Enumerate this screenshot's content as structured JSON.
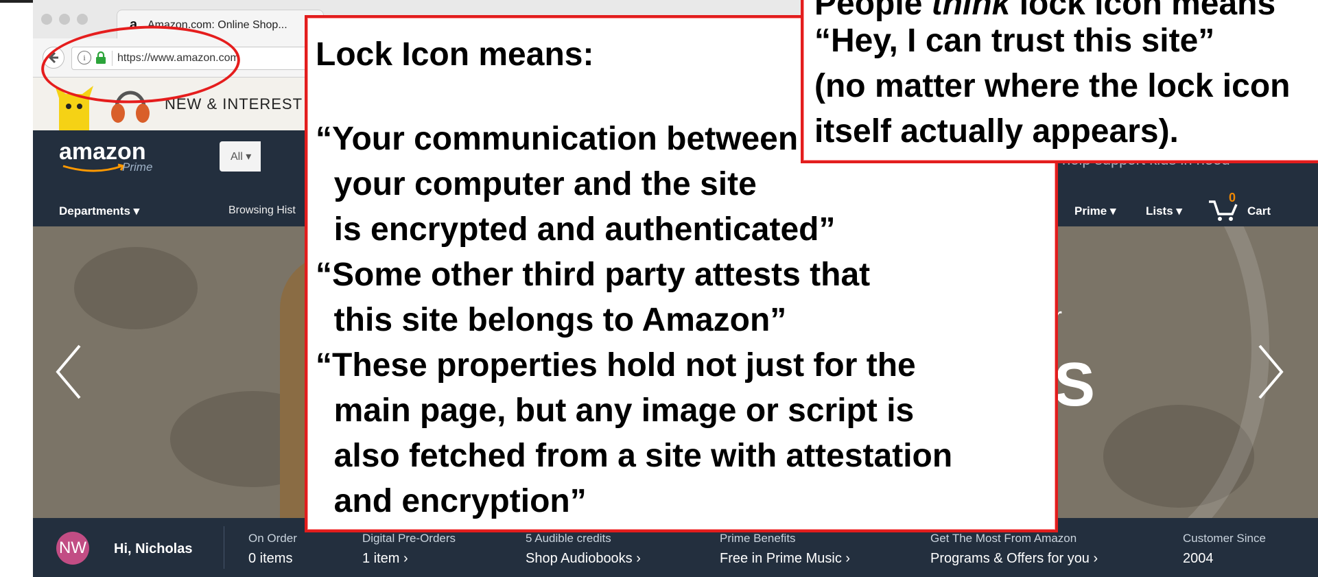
{
  "browser": {
    "tab_title": "Amazon.com: Online Shop...",
    "tab_close": "×",
    "favicon": "a",
    "url": "https://www.amazon.com",
    "info_icon": "i"
  },
  "promo": {
    "text": "NEW & INTEREST"
  },
  "amazon": {
    "logo": "amazon",
    "logo_sub": "Prime",
    "search_category": "All ▾",
    "nav": {
      "departments": "Departments ▾",
      "browsing_history": "Browsing Hist",
      "prime": "Prime ▾",
      "lists": "Lists ▾",
      "cart_count": "0",
      "cart": "Cart",
      "help_text": "help support kids in need"
    },
    "hero": {
      "fragment_r": "r",
      "fragment_s": "S"
    }
  },
  "footer": {
    "avatar": "NW",
    "greeting": "Hi, Nicholas",
    "items": [
      {
        "label": "On Order",
        "value": "0 items"
      },
      {
        "label": "Digital Pre-Orders",
        "value": "1 item ›"
      },
      {
        "label": "5 Audible credits",
        "value": "Shop Audiobooks ›"
      },
      {
        "label": "Prime Benefits",
        "value": "Free in Prime Music ›"
      },
      {
        "label": "Get The Most From Amazon",
        "value": "Programs & Offers for you ›"
      },
      {
        "label": "Customer Since",
        "value": "2004"
      }
    ]
  },
  "annotation_main": {
    "heading": "Lock Icon means:",
    "items": [
      "“Your communication between",
      "  your computer and the site",
      "  is encrypted and authenticated”",
      "“Some other third party attests that",
      "  this site belongs to Amazon”",
      "“These properties hold not just for the",
      "  main page, but any image or script is",
      "  also fetched from a site with attestation",
      "  and encryption”"
    ]
  },
  "annotation_top": {
    "line0_a": "People ",
    "line0_em": "think",
    "line0_b": " lock icon means",
    "line1": "“Hey, I can trust this site”",
    "line2": "(no matter where the lock icon",
    "line3": "itself actually appears)."
  },
  "colors": {
    "amazon_navy": "#232f3e",
    "annotation_red": "#e21d1d",
    "cart_orange": "#f08804"
  }
}
